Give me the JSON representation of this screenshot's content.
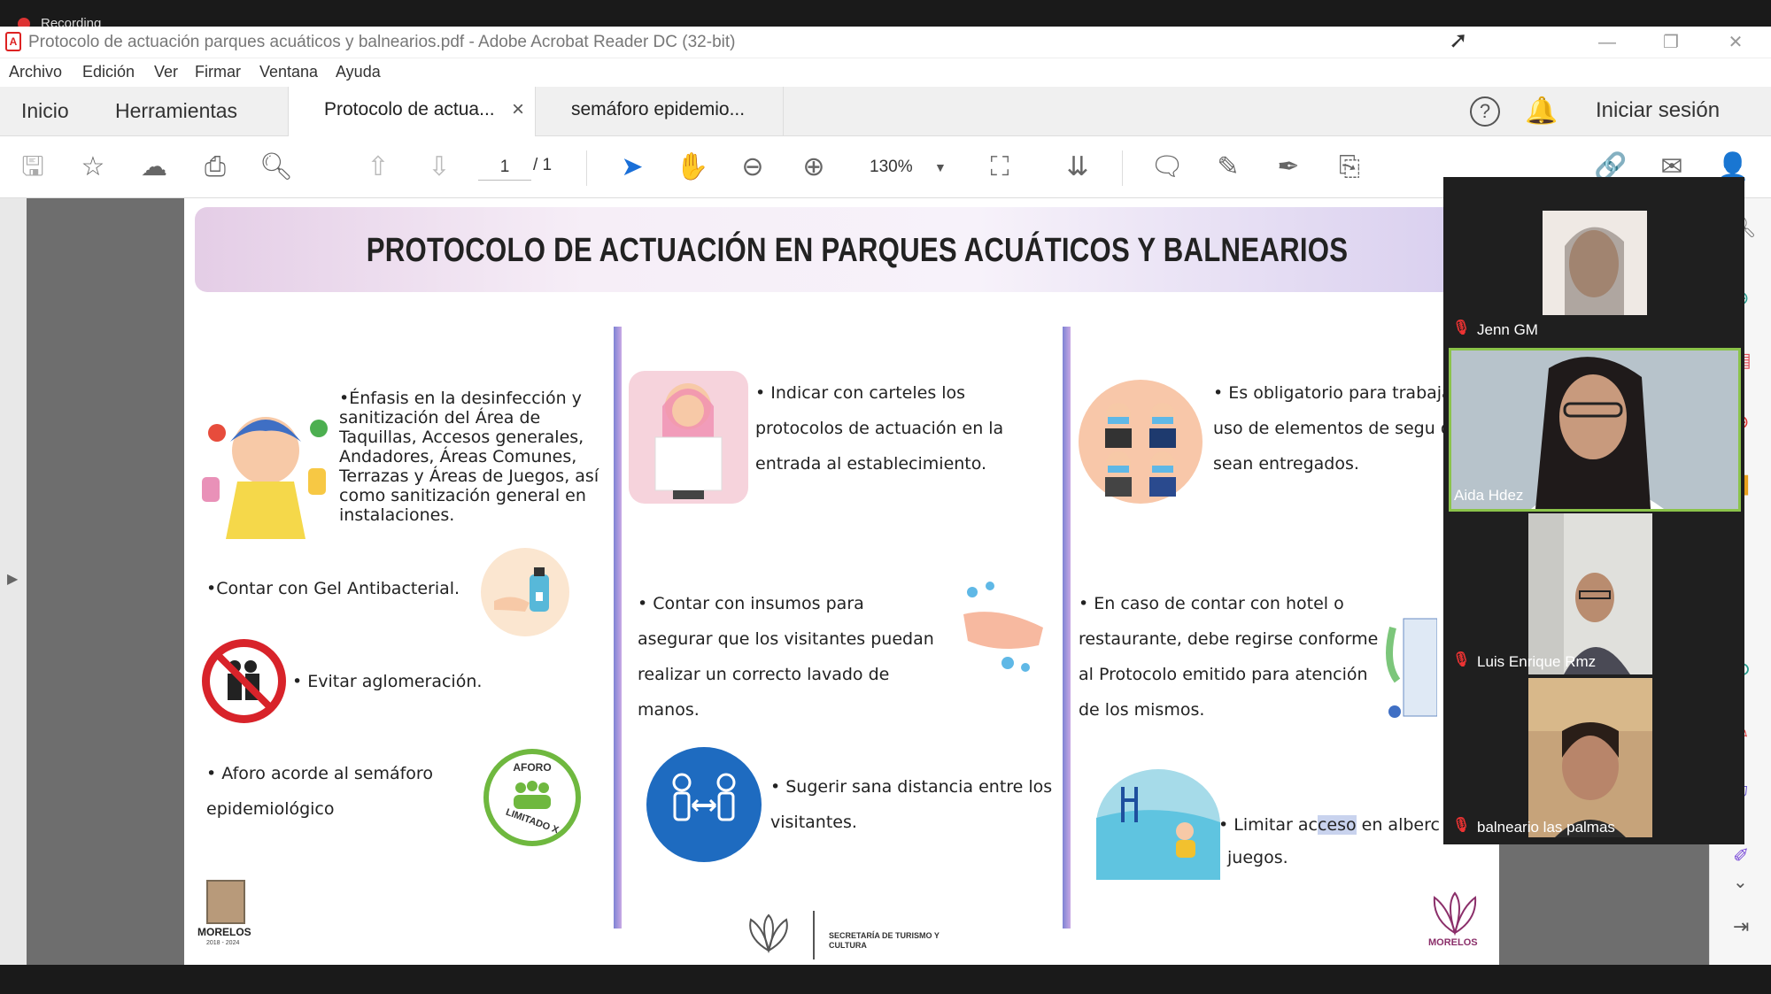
{
  "recording": {
    "label": "Recording"
  },
  "window": {
    "title": "Protocolo de actuación parques acuáticos y balnearios.pdf - Adobe Acrobat Reader DC (32-bit)"
  },
  "menu": [
    "Archivo",
    "Edición",
    "Ver",
    "Firmar",
    "Ventana",
    "Ayuda"
  ],
  "tabs": {
    "home": "Inicio",
    "tools": "Herramientas",
    "doc1": "Protocolo de actua...",
    "doc1_close": "×",
    "doc2": "semáforo epidemio...",
    "signin": "Iniciar sesión"
  },
  "toolbar": {
    "page_current": "1",
    "page_total": "/ 1",
    "zoom": "130%"
  },
  "pdf": {
    "title": "PROTOCOLO DE ACTUACIÓN EN PARQUES ACUÁTICOS Y BALNEARIOS",
    "col1": {
      "item1": "•Énfasis en la desinfección y sanitización del Área de Taquillas, Accesos generales, Andadores, Áreas Comunes, Terrazas y Áreas de Juegos, así como sanitización general en instalaciones.",
      "item2": "•Contar con Gel Antibacterial.",
      "item3": "• Evitar aglomeración.",
      "item4": "• Aforo acorde al semáforo epidemiológico",
      "aforo_badge_top": "AFORO",
      "aforo_badge_bottom": "LIMITADO X",
      "logo_left": "MORELOS",
      "logo_left_years": "2018 - 2024"
    },
    "col2": {
      "item1": "• Indicar con carteles los protocolos de actuación en la entrada al establecimiento.",
      "item2": "• Contar con insumos para asegurar que los visitantes puedan realizar un correcto lavado de manos.",
      "item3": "• Sugerir sana distancia entre los visitantes.",
      "footer_logo": "SECRETARÍA DE TURISMO Y CULTURA"
    },
    "col3": {
      "item1": "• Es obligatorio para  trabaja el uso de elementos de segu que le sean entregados.",
      "item2": "• En caso de contar con  hotel o restaurante, debe regirse conforme al Protocolo emitido para atención de los mismos.",
      "item3_a": "• Limitar ac",
      "item3_b": "ceso",
      "item3_c": " en alberc",
      "item3_d": "juegos.",
      "logo_right": "MORELOS"
    }
  },
  "participants": [
    {
      "name": "Jenn GM"
    },
    {
      "name": "Aida Hdez"
    },
    {
      "name": "Luis Enrique Rmz"
    },
    {
      "name": "balneario las palmas"
    }
  ],
  "colors": {
    "accent_pdf_red": "#d22222",
    "speaker_border": "#8bc34a",
    "title_banner": "#e4cde6"
  }
}
